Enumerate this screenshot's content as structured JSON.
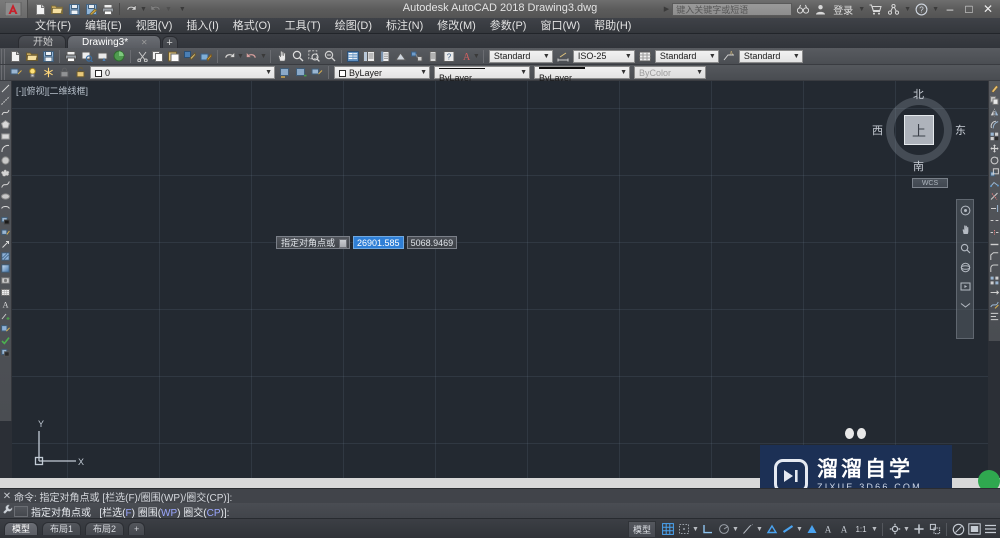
{
  "window": {
    "title": "Autodesk AutoCAD 2018  Drawing3.dwg",
    "app_logo": "autocad-a-logo",
    "minimize": "–",
    "maximize": "□",
    "close": "✕"
  },
  "search": {
    "placeholder": "键入关键字或短语",
    "value": "",
    "search_icon": "binoculars-icon",
    "account_icon": "user-icon",
    "signin_label": "登录",
    "cart_icon": "cart-icon",
    "share_icon": "share-icon",
    "help_icon": "help-icon"
  },
  "quick_access": [
    {
      "name": "new-file-icon",
      "glyph": "new"
    },
    {
      "name": "open-file-icon",
      "glyph": "open"
    },
    {
      "name": "save-icon",
      "glyph": "save"
    },
    {
      "name": "save-as-icon",
      "glyph": "saveas"
    },
    {
      "name": "plot-icon",
      "glyph": "plot"
    },
    {
      "name": "undo-icon",
      "glyph": "undo"
    },
    {
      "name": "redo-icon",
      "glyph": "redo"
    }
  ],
  "menu": [
    {
      "label": "文件(F)"
    },
    {
      "label": "编辑(E)"
    },
    {
      "label": "视图(V)"
    },
    {
      "label": "插入(I)"
    },
    {
      "label": "格式(O)"
    },
    {
      "label": "工具(T)"
    },
    {
      "label": "绘图(D)"
    },
    {
      "label": "标注(N)"
    },
    {
      "label": "修改(M)"
    },
    {
      "label": "参数(P)"
    },
    {
      "label": "窗口(W)"
    },
    {
      "label": "帮助(H)"
    }
  ],
  "file_tabs": {
    "start_label": "开始",
    "drawing_label": "Drawing3*",
    "close_glyph": "✕",
    "new_tab": "+"
  },
  "toolbar_row1": {
    "styles": [
      {
        "name": "text-style-combo",
        "label": "Standard"
      },
      {
        "name": "dim-style-combo",
        "label": "ISO-25"
      },
      {
        "name": "table-style-combo",
        "label": "Standard"
      },
      {
        "name": "mleader-style-combo",
        "label": "Standard"
      }
    ]
  },
  "toolbar_row2": {
    "layer_name": "0",
    "color_label": "ByLayer",
    "linetype_label": "ByLayer",
    "lineweight_label": "ByLayer",
    "plotstyle_label": "ByColor"
  },
  "canvas": {
    "viewport_label": "[-][俯视][二维线框]",
    "background_color": "#232931",
    "ucs": {
      "x_label": "X",
      "y_label": "Y"
    },
    "dynamic_input": {
      "prompt": "指定对角点或",
      "field1_value": "26901.585",
      "field1_selected": true,
      "field2_value": "5068.9469"
    }
  },
  "viewcube": {
    "top_face": "上",
    "north": "北",
    "south": "南",
    "west": "西",
    "east": "东",
    "ucs_button": "WCS"
  },
  "command_line": {
    "history": "命令: 指定对角点或 [栏选(F)/圈围(WP)/圈交(CP)]:",
    "prompt_text": "指定对角点或",
    "options": [
      {
        "text": "栏选(",
        "key": "F",
        "close": ")"
      },
      {
        "text": "圈围(",
        "key": "WP",
        "close": ")"
      },
      {
        "text": "圈交(",
        "key": "CP",
        "close": ")"
      }
    ],
    "open_bracket": "[",
    "close_bracket": "]:",
    "close_icon": "✕",
    "customize_icon": "wrench-icon"
  },
  "layout_tabs": [
    {
      "label": "模型",
      "active": true
    },
    {
      "label": "布局1",
      "active": false
    },
    {
      "label": "布局2",
      "active": false
    },
    {
      "label": "+",
      "active": false
    }
  ],
  "status_bar": {
    "model_label": "模型",
    "items": [
      {
        "name": "grid-display-toggle",
        "icon": "grid-icon",
        "on": true
      },
      {
        "name": "snap-mode-toggle",
        "icon": "snap-icon",
        "on": false
      },
      {
        "name": "ortho-mode-toggle",
        "icon": "ortho-icon",
        "on": false
      },
      {
        "name": "polar-tracking-toggle",
        "icon": "polar-icon",
        "on": false
      },
      {
        "name": "object-snap-tracking-toggle",
        "icon": "osnap-track-icon",
        "on": false
      },
      {
        "name": "object-snap-toggle",
        "icon": "osnap-icon",
        "on": true
      },
      {
        "name": "lineweight-toggle",
        "icon": "lineweight-icon",
        "on": true
      },
      {
        "name": "transparency-toggle",
        "icon": "transparency-icon",
        "on": true
      },
      {
        "name": "selection-cycling-toggle",
        "icon": "selection-cycling-icon",
        "on": false
      },
      {
        "name": "annotation-visibility-toggle",
        "icon": "annotation-icon",
        "on": false
      },
      {
        "name": "annotation-scale",
        "icon": "scale-icon",
        "label": "1:1"
      },
      {
        "name": "workspace-switch",
        "icon": "gear-icon",
        "on": false
      },
      {
        "name": "hardware-accel-toggle",
        "icon": "plus-icon",
        "on": false
      },
      {
        "name": "isolate-objects-toggle",
        "icon": "isolate-icon",
        "on": false
      },
      {
        "name": "clean-screen-toggle",
        "icon": "clean-screen-icon",
        "on": false
      },
      {
        "name": "customization-menu",
        "icon": "hamburger-icon",
        "on": false
      }
    ],
    "annotation_scale_label": "1:1"
  },
  "watermark": {
    "main": "溜溜自学",
    "sub": "ZIXUE.3D66.COM",
    "play_icon": "play-button-icon",
    "background_color": "#1c3055"
  }
}
